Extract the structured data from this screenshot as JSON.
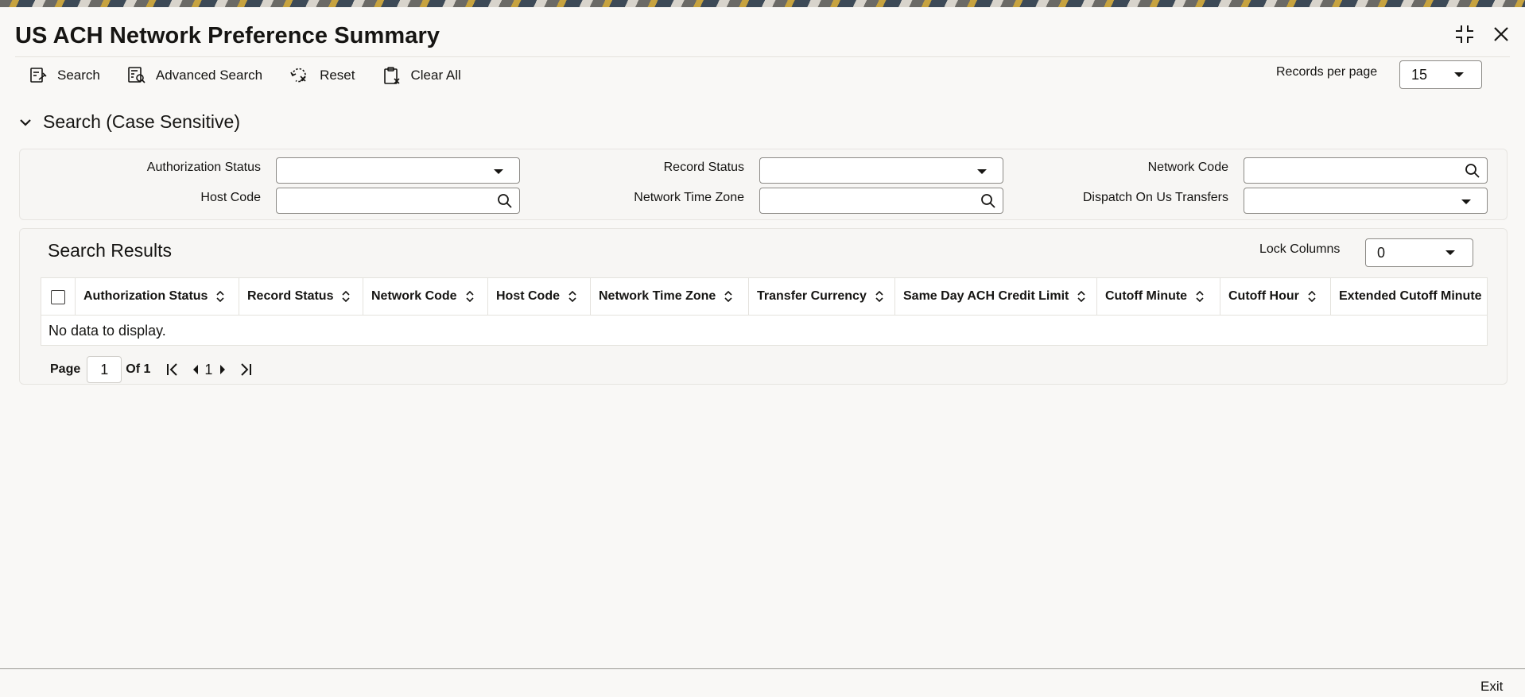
{
  "window": {
    "title": "US ACH Network Preference Summary",
    "controls": [
      "maximize-icon",
      "close-icon"
    ]
  },
  "toolbar": {
    "search_label": "Search",
    "advanced_search_label": "Advanced Search",
    "reset_label": "Reset",
    "clear_all_label": "Clear All",
    "records_per_page_label": "Records per page",
    "records_per_page_value": "15"
  },
  "search_section": {
    "title": "Search (Case Sensitive)",
    "fields": {
      "authorization_status": {
        "label": "Authorization Status",
        "value": ""
      },
      "record_status": {
        "label": "Record Status",
        "value": ""
      },
      "network_code": {
        "label": "Network Code",
        "value": ""
      },
      "host_code": {
        "label": "Host Code",
        "value": ""
      },
      "network_time_zone": {
        "label": "Network Time Zone",
        "value": ""
      },
      "dispatch_on_us_transfers": {
        "label": "Dispatch On Us Transfers",
        "value": ""
      }
    }
  },
  "results": {
    "title": "Search Results",
    "lock_columns_label": "Lock Columns",
    "lock_columns_value": "0",
    "columns": [
      "Authorization Status",
      "Record Status",
      "Network Code",
      "Host Code",
      "Network Time Zone",
      "Transfer Currency",
      "Same Day ACH Credit Limit",
      "Cutoff Minute",
      "Cutoff Hour",
      "Extended Cutoff Minute"
    ],
    "empty_message": "No data to display."
  },
  "pagination": {
    "page_label": "Page",
    "current_page": "1",
    "of_label": "Of 1",
    "current_page_link": "1"
  },
  "footer": {
    "exit_label": "Exit"
  }
}
